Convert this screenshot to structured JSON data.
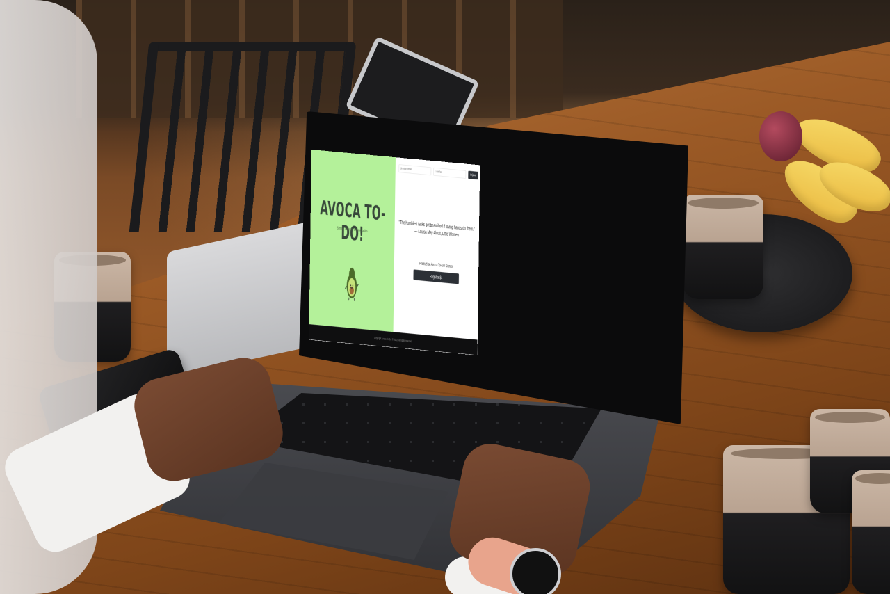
{
  "app": {
    "brand_title": "AVOCA TO-DO!",
    "tagline": "Simple, accurate and avocados.",
    "mascot_icon": "avocado-mascot-icon",
    "accent_green": "#b4f19a",
    "button_dark": "#2c3036"
  },
  "login": {
    "email_placeholder": "Unesite email",
    "password_placeholder": "Lozinka",
    "submit_label": "Prijava"
  },
  "hero": {
    "quote": "\"The humblest tasks get beautified if loving hands do them.\"",
    "quote_author": "— Louisa May Alcott, Little Women",
    "signup_prompt": "Pridruži se Avoca To-Do! Danas.",
    "signup_label": "Registracija"
  },
  "footer": {
    "copyright": "Copyright Avoca To-Do! © 2022. All rights reserved."
  }
}
